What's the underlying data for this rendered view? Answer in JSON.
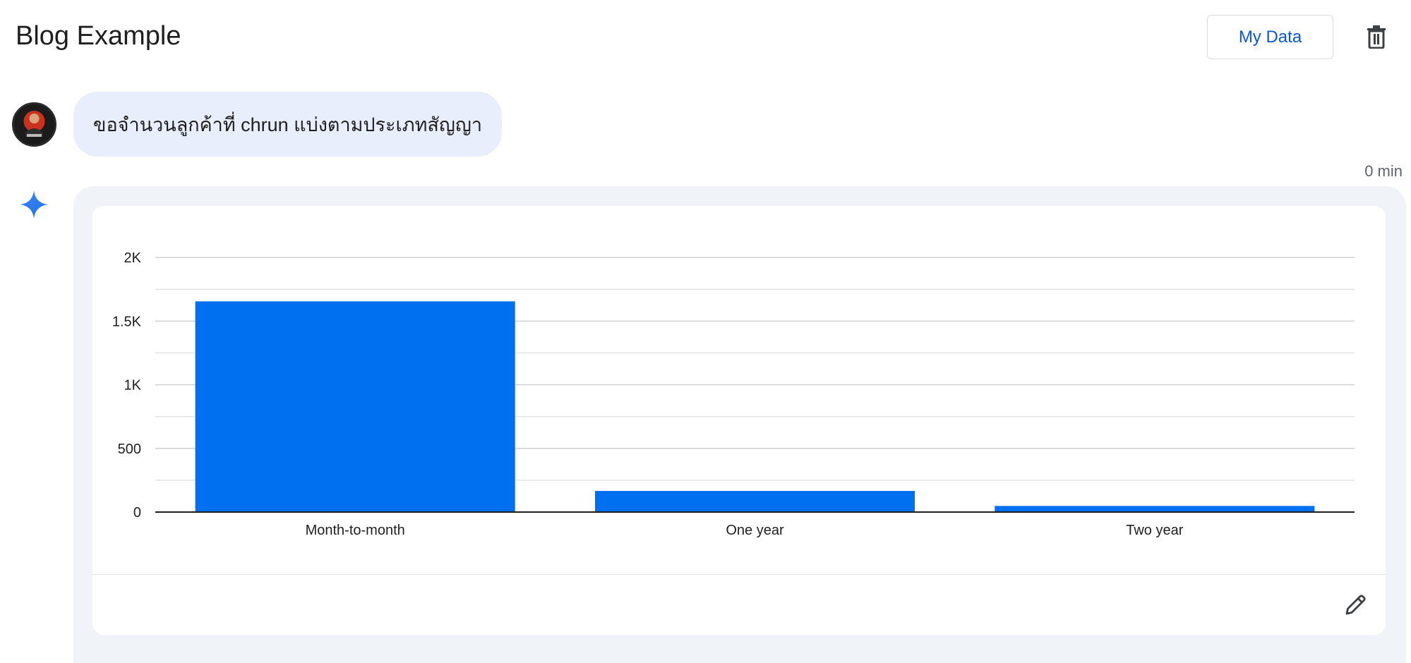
{
  "header": {
    "title": "Blog Example",
    "my_data_label": "My Data",
    "delete_icon": "trash-icon"
  },
  "conversation": {
    "user_message": "ขอจำนวนลูกค้าที่ chrun แบ่งตามประเภทสัญญา",
    "timestamp": "0 min",
    "assistant_icon": "sparkle-icon"
  },
  "colors": {
    "accent": "#0b57d0",
    "bar": "#0070f0",
    "bubble": "#e9eefc",
    "panel": "#f0f4f9"
  },
  "chart_data": {
    "type": "bar",
    "categories": [
      "Month-to-month",
      "One year",
      "Two year"
    ],
    "values": [
      1655,
      166,
      48
    ],
    "ylim": [
      0,
      2000
    ],
    "yticks": [
      {
        "value": 0,
        "label": "0"
      },
      {
        "value": 500,
        "label": "500"
      },
      {
        "value": 1000,
        "label": "1K"
      },
      {
        "value": 1500,
        "label": "1.5K"
      },
      {
        "value": 2000,
        "label": "2K"
      }
    ],
    "minor_grid": [
      250,
      750,
      1250,
      1750
    ],
    "grid": true,
    "legend": "none"
  },
  "footer": {
    "edit_icon": "pencil-icon"
  }
}
